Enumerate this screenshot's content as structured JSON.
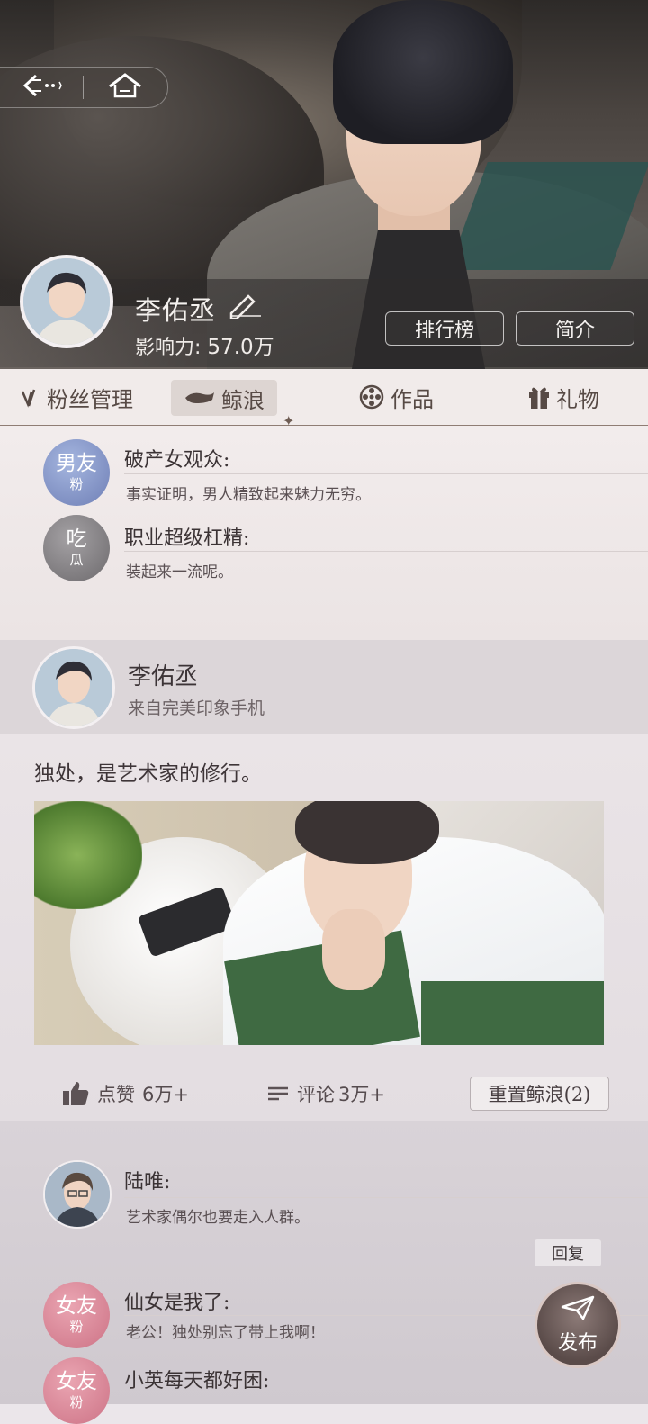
{
  "nav": {
    "back_icon": "back-arrow-icon",
    "home_icon": "home-icon"
  },
  "profile": {
    "name": "李佑丞",
    "influence_label": "影响力:",
    "influence_value": "57.0万",
    "ranking_button": "排行榜",
    "intro_button": "简介"
  },
  "tabs": [
    {
      "label": "粉丝管理",
      "icon": "check-mark-icon"
    },
    {
      "label": "鲸浪",
      "icon": "whale-icon",
      "active": true
    },
    {
      "label": "作品",
      "icon": "film-reel-icon"
    },
    {
      "label": "礼物",
      "icon": "gift-icon"
    }
  ],
  "top_comments": [
    {
      "badge_main": "男友",
      "badge_sub": "粉",
      "name": "破产女观众:",
      "text": "事实证明，男人精致起来魅力无穷。"
    },
    {
      "badge_main": "吃",
      "badge_sub": "瓜",
      "name": "职业超级杠精:",
      "text": "装起来一流呢。"
    }
  ],
  "post": {
    "author": "李佑丞",
    "source": "来自完美印象手机",
    "text": "独处，是艺术家的修行。",
    "like_label": "点赞",
    "like_count": "6万+",
    "comment_label": "评论",
    "comment_count": "3万+",
    "reset_button": "重置鲸浪(2)"
  },
  "lower_comments": [
    {
      "name": "陆唯:",
      "text": "艺术家偶尔也要走入人群。"
    },
    {
      "badge_main": "女友",
      "badge_sub": "粉",
      "name": "仙女是我了:",
      "text": "老公！独处别忘了带上我啊！"
    },
    {
      "badge_main": "女友",
      "badge_sub": "粉",
      "name": "小英每天都好困:",
      "text": ""
    }
  ],
  "reply_button": "回复",
  "publish_button": "发布",
  "colors": {
    "accent": "#6e5c53",
    "tab_active_bg": "#ddd5d2"
  }
}
